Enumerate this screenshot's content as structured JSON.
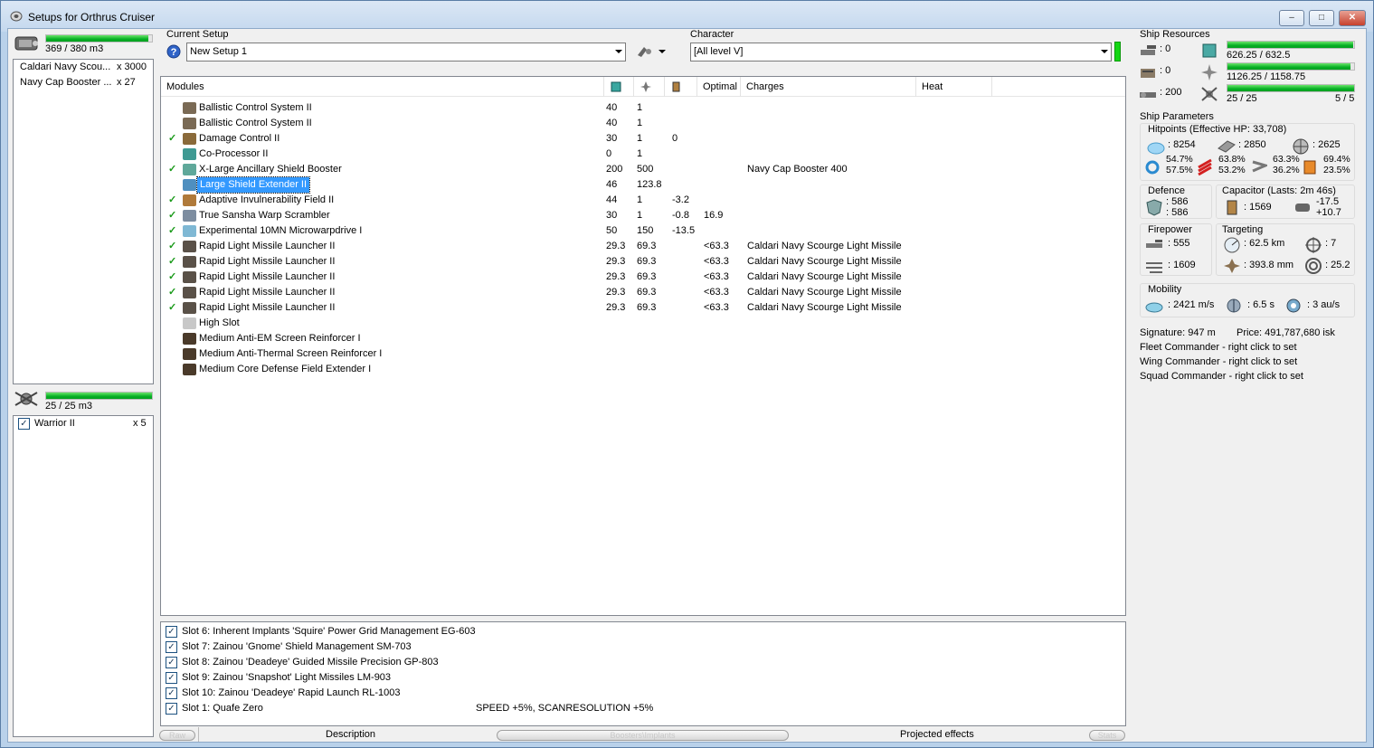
{
  "window": {
    "title": "Setups for Orthrus Cruiser"
  },
  "cargo": {
    "capacity": "369 / 380 m3",
    "fill": 0.97,
    "items": [
      {
        "name": "Caldari Navy Scou...",
        "qty": "x 3000"
      },
      {
        "name": "Navy Cap Booster ...",
        "qty": "x 27"
      }
    ]
  },
  "drones": {
    "capacity": "25 / 25 m3",
    "fill": 1.0,
    "items": [
      {
        "name": "Warrior II",
        "qty": "x 5",
        "checked": true
      }
    ]
  },
  "setup": {
    "label": "Current Setup",
    "value": "New Setup 1"
  },
  "character": {
    "label": "Character",
    "value": "[All level V]"
  },
  "modules": {
    "headers": [
      "Modules",
      "",
      "",
      "",
      "Optimal",
      "Charges",
      "Heat"
    ],
    "rows": [
      {
        "icon": "ballistic-control-icon",
        "online": false,
        "name": "Ballistic Control System II",
        "cpu": "40",
        "pg": "1",
        "cap": "",
        "optimal": "",
        "charges": ""
      },
      {
        "icon": "ballistic-control-icon",
        "online": false,
        "name": "Ballistic Control System II",
        "cpu": "40",
        "pg": "1",
        "cap": "",
        "optimal": "",
        "charges": ""
      },
      {
        "icon": "damage-control-icon",
        "online": true,
        "name": "Damage Control II",
        "cpu": "30",
        "pg": "1",
        "cap": "0",
        "optimal": "",
        "charges": ""
      },
      {
        "icon": "co-processor-icon",
        "online": false,
        "name": "Co-Processor II",
        "cpu": "0",
        "pg": "1",
        "cap": "",
        "optimal": "",
        "charges": ""
      },
      {
        "icon": "shield-booster-icon",
        "online": true,
        "name": "X-Large Ancillary Shield Booster",
        "cpu": "200",
        "pg": "500",
        "cap": "",
        "optimal": "",
        "charges": "Navy Cap Booster 400"
      },
      {
        "icon": "shield-extender-icon",
        "online": false,
        "name": "Large Shield Extender II",
        "cpu": "46",
        "pg": "123.8",
        "cap": "",
        "optimal": "",
        "charges": "",
        "selected": true
      },
      {
        "icon": "invulnerability-field-icon",
        "online": true,
        "name": "Adaptive Invulnerability Field II",
        "cpu": "44",
        "pg": "1",
        "cap": "-3.2",
        "optimal": "",
        "charges": ""
      },
      {
        "icon": "warp-scrambler-icon",
        "online": true,
        "name": "True Sansha Warp Scrambler",
        "cpu": "30",
        "pg": "1",
        "cap": "-0.8",
        "optimal": "16.9",
        "charges": ""
      },
      {
        "icon": "microwarpdrive-icon",
        "online": true,
        "name": "Experimental 10MN Microwarpdrive I",
        "cpu": "50",
        "pg": "150",
        "cap": "-13.5",
        "optimal": "",
        "charges": ""
      },
      {
        "icon": "missile-launcher-icon",
        "online": true,
        "name": "Rapid Light Missile Launcher II",
        "cpu": "29.3",
        "pg": "69.3",
        "cap": "",
        "optimal": "<63.3",
        "charges": "Caldari Navy Scourge Light Missile"
      },
      {
        "icon": "missile-launcher-icon",
        "online": true,
        "name": "Rapid Light Missile Launcher II",
        "cpu": "29.3",
        "pg": "69.3",
        "cap": "",
        "optimal": "<63.3",
        "charges": "Caldari Navy Scourge Light Missile"
      },
      {
        "icon": "missile-launcher-icon",
        "online": true,
        "name": "Rapid Light Missile Launcher II",
        "cpu": "29.3",
        "pg": "69.3",
        "cap": "",
        "optimal": "<63.3",
        "charges": "Caldari Navy Scourge Light Missile"
      },
      {
        "icon": "missile-launcher-icon",
        "online": true,
        "name": "Rapid Light Missile Launcher II",
        "cpu": "29.3",
        "pg": "69.3",
        "cap": "",
        "optimal": "<63.3",
        "charges": "Caldari Navy Scourge Light Missile"
      },
      {
        "icon": "missile-launcher-icon",
        "online": true,
        "name": "Rapid Light Missile Launcher II",
        "cpu": "29.3",
        "pg": "69.3",
        "cap": "",
        "optimal": "<63.3",
        "charges": "Caldari Navy Scourge Light Missile"
      },
      {
        "icon": "high-slot-icon",
        "online": false,
        "name": "High Slot",
        "cpu": "",
        "pg": "",
        "cap": "",
        "optimal": "",
        "charges": ""
      },
      {
        "icon": "rig-icon",
        "online": false,
        "name": "Medium Anti-EM Screen Reinforcer I",
        "cpu": "",
        "pg": "",
        "cap": "",
        "optimal": "",
        "charges": ""
      },
      {
        "icon": "rig-icon",
        "online": false,
        "name": "Medium Anti-Thermal Screen Reinforcer I",
        "cpu": "",
        "pg": "",
        "cap": "",
        "optimal": "",
        "charges": ""
      },
      {
        "icon": "rig-icon",
        "online": false,
        "name": "Medium Core Defense Field Extender I",
        "cpu": "",
        "pg": "",
        "cap": "",
        "optimal": "",
        "charges": ""
      }
    ]
  },
  "implants": [
    {
      "label": "Slot 6: Inherent Implants 'Squire' Power Grid Management EG-603",
      "effect": ""
    },
    {
      "label": "Slot 7: Zainou 'Gnome' Shield Management SM-703",
      "effect": ""
    },
    {
      "label": "Slot 8: Zainou 'Deadeye' Guided Missile Precision GP-803",
      "effect": ""
    },
    {
      "label": "Slot 9: Zainou 'Snapshot' Light Missiles LM-903",
      "effect": ""
    },
    {
      "label": "Slot 10: Zainou 'Deadeye' Rapid Launch RL-1003",
      "effect": ""
    },
    {
      "label": "Slot 1: Quafe Zero",
      "effect": "SPEED +5%, SCANRESOLUTION +5%"
    }
  ],
  "status_tabs": {
    "raw": "Raw",
    "description": "Description",
    "boosters": "Boosters\\Implants",
    "projected": "Projected effects",
    "stats": "Stats"
  },
  "resources": {
    "title": "Ship Resources",
    "turrets": ": 0",
    "launchers": ": 0",
    "calibration": ": 200",
    "cpu": {
      "text": "626.25 / 632.5",
      "fill": 0.99
    },
    "powergrid": {
      "text": "1126.25 / 1158.75",
      "fill": 0.97
    },
    "drone_bay": {
      "text": "25 / 25",
      "extra": "5 / 5",
      "fill": 1.0
    }
  },
  "parameters": {
    "title": "Ship Parameters",
    "hitpoints_title": "Hitpoints (Effective HP: 33,708)",
    "shield_hp": ": 8254",
    "armor_hp": ": 2850",
    "structure_hp": ": 2625",
    "resists": {
      "em": [
        "54.7%",
        "57.5%"
      ],
      "thermal": [
        "63.8%",
        "53.2%"
      ],
      "kinetic": [
        "63.3%",
        "36.2%"
      ],
      "explosive": [
        "69.4%",
        "23.5%"
      ]
    },
    "defence_title": "Defence",
    "defence": [
      ": 586",
      ": 586"
    ],
    "capacitor_title": "Capacitor (Lasts: 2m 46s)",
    "capacitor": ": 1569",
    "cap_delta": [
      "-17.5",
      "+10.7"
    ],
    "firepower_title": "Firepower",
    "firepower": [
      ": 555",
      ": 1609"
    ],
    "targeting_title": "Targeting",
    "targeting": {
      "range": ": 62.5 km",
      "max_targets": ": 7",
      "scan_res": ": 393.8 mm",
      "sensor": ": 25.2"
    },
    "mobility_title": "Mobility",
    "mobility": {
      "speed": ": 2421 m/s",
      "align": ": 6.5 s",
      "warp": ": 3 au/s"
    },
    "signature": "Signature: 947 m",
    "price": "Price: 491,787,680 isk",
    "fleet": "Fleet Commander - right click to set",
    "wing": "Wing Commander - right click to set",
    "squad": "Squad Commander - right click to set"
  },
  "colors": {
    "accent": "#3399ff",
    "bar_green": "#06b025",
    "check_green": "#1a9a1a"
  }
}
